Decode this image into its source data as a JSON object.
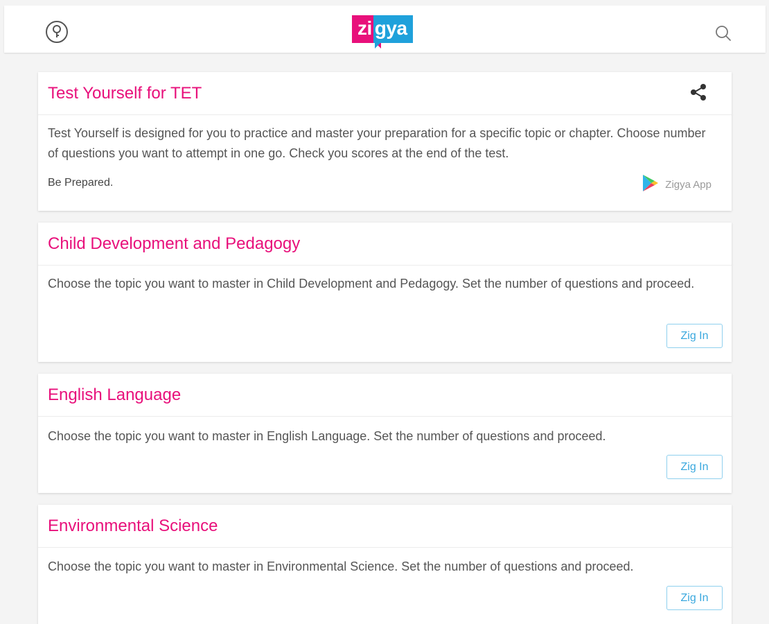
{
  "header": {
    "help_icon": "help-circle-icon",
    "search_icon": "search-icon",
    "logo": {
      "left": "zi",
      "right": "gya",
      "colors": {
        "pink": "#e8107b",
        "blue": "#1fa1db"
      }
    }
  },
  "intro_card": {
    "title": "Test Yourself for TET",
    "share_icon": "share-icon",
    "description": "Test Yourself is designed for you to practice and master your preparation for a specific topic or chapter. Choose number of questions you want to attempt in one go. Check you scores at the end of the test.",
    "tagline": "Be Prepared.",
    "app_link": {
      "label": "Zigya App",
      "icon": "play-store-icon"
    }
  },
  "subjects": [
    {
      "title": "Child Development and Pedagogy",
      "description": "Choose the topic you want to master in Child Development and Pedagogy. Set the number of questions and proceed.",
      "button": "Zig In"
    },
    {
      "title": "English Language",
      "description": "Choose the topic you want to master in English Language. Set the number of questions and proceed.",
      "button": "Zig In"
    },
    {
      "title": "Environmental Science",
      "description": "Choose the topic you want to master in Environmental Science. Set the number of questions and proceed.",
      "button": "Zig In"
    }
  ],
  "colors": {
    "accent": "#e8107b",
    "button_text": "#3aa8de",
    "button_border": "#8fd0ee"
  }
}
